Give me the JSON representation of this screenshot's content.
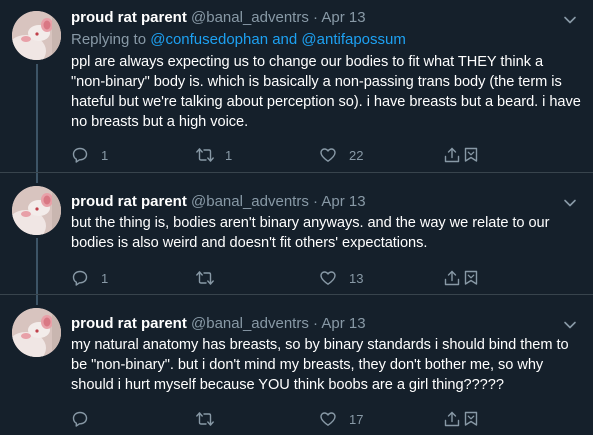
{
  "colors": {
    "background": "#15202b",
    "text": "#ffffff",
    "muted": "#8899a6",
    "link": "#1da1f2",
    "divider": "#38444d"
  },
  "tweets": [
    {
      "display_name": "proud rat parent",
      "handle": "@banal_adventrs",
      "separator": "·",
      "date": "Apr 13",
      "replying_prefix": "Replying to",
      "replying_first": "@confusedophan",
      "replying_and": "and",
      "replying_second": "@antifapossum",
      "text": "ppl are always expecting us to change our bodies to fit what THEY think a \"non-binary\" body is. which is basically a non-passing trans body (the term is hateful but we're talking about perception so). i have breasts but a beard. i have no breasts but a high voice.",
      "reply_icon": "comment-icon",
      "replies": "1",
      "retweet_icon": "retweet-icon",
      "retweets": "1",
      "like_icon": "heart-icon",
      "likes": "22",
      "share_icon": "share-icon",
      "bookmark_icon": "bookmark-icon"
    },
    {
      "display_name": "proud rat parent",
      "handle": "@banal_adventrs",
      "separator": "·",
      "date": "Apr 13",
      "text": "but the thing is, bodies aren't binary anyways. and the way we relate to our bodies is also weird and doesn't fit others' expectations.",
      "replies": "1",
      "retweets": "",
      "likes": "13"
    },
    {
      "display_name": "proud rat parent",
      "handle": "@banal_adventrs",
      "separator": "·",
      "date": "Apr 13",
      "text": "my natural anatomy has breasts, so by binary standards i should bind them to be \"non-binary\". but i don't mind my breasts, they don't bother me, so why should i hurt myself because YOU think boobs are a girl thing?????",
      "replies": "",
      "retweets": "",
      "likes": "17"
    }
  ]
}
